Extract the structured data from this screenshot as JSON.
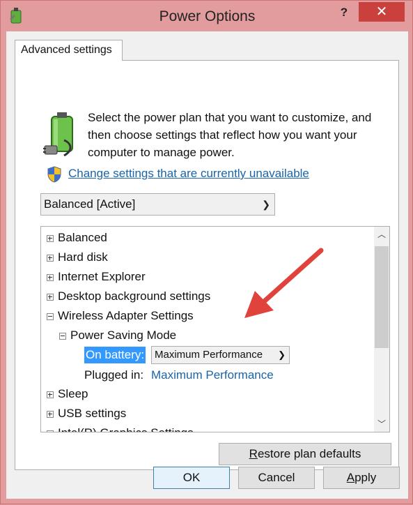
{
  "window": {
    "title": "Power Options",
    "help_label": "?",
    "close_label": "✕"
  },
  "tab": {
    "label": "Advanced settings"
  },
  "intro": {
    "text": "Select the power plan that you want to customize, and then choose settings that reflect how you want your computer to manage power."
  },
  "link": {
    "text": "Change settings that are currently unavailable"
  },
  "plan_select": {
    "value": "Balanced [Active]"
  },
  "tree": {
    "items": [
      {
        "label": "Balanced",
        "expanded": false
      },
      {
        "label": "Hard disk",
        "expanded": false
      },
      {
        "label": "Internet Explorer",
        "expanded": false
      },
      {
        "label": "Desktop background settings",
        "expanded": false
      },
      {
        "label": "Wireless Adapter Settings",
        "expanded": true
      },
      {
        "label": "Power Saving Mode",
        "expanded": true
      },
      {
        "label": "Sleep",
        "expanded": false
      },
      {
        "label": "USB settings",
        "expanded": false
      },
      {
        "label": "Intel(R) Graphics Settings",
        "expanded": false
      }
    ],
    "on_battery_label": "On battery:",
    "on_battery_value": "Maximum Performance",
    "plugged_in_label": "Plugged in:",
    "plugged_in_value": "Maximum Performance"
  },
  "buttons": {
    "restore_prefix": "R",
    "restore_rest": "estore plan defaults",
    "ok": "OK",
    "cancel": "Cancel",
    "apply_prefix": "A",
    "apply_rest": "pply"
  },
  "colors": {
    "frame": "#e39c9e",
    "close": "#c9403d",
    "link": "#1a64a8",
    "selection": "#3399ff",
    "annotation_arrow": "#e0433b"
  }
}
